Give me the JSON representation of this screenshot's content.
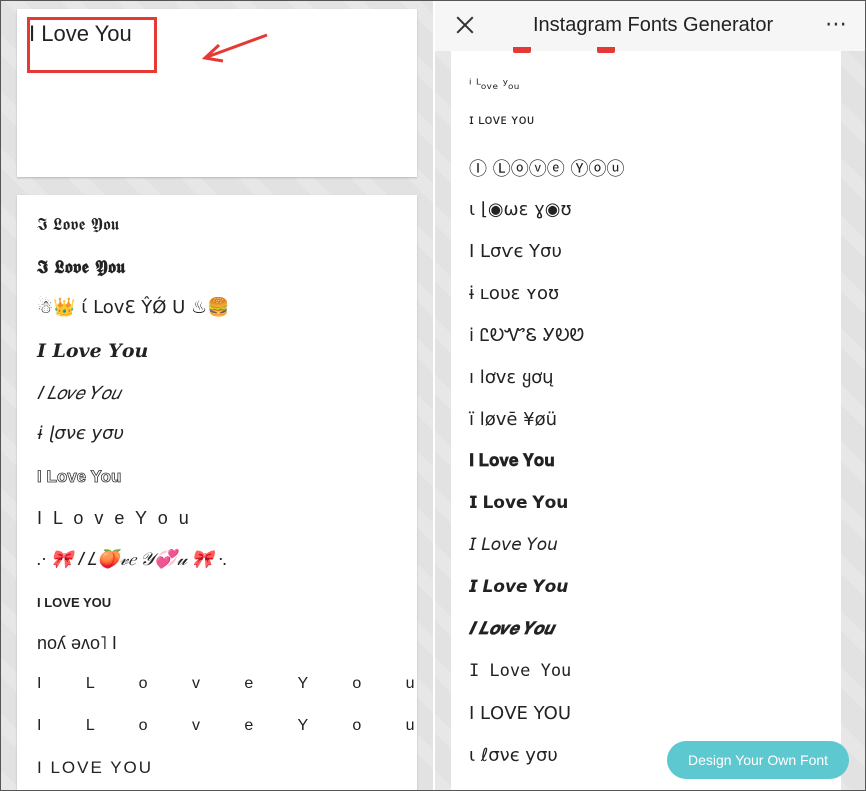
{
  "input": {
    "value": "I Love You"
  },
  "left_fonts": [
    "𝕴 𝕷𝖔𝖛𝖊 𝖄𝖔𝖚",
    "𝕴 𝕷𝖔𝖛𝖊 𝖄𝖔𝖚",
    "☃👑  ί LovƐ ŶǾ U  ♨🍔",
    "𝑰 𝑳𝒐𝒗𝒆 𝒀𝒐𝒖",
    "𝐼 𝐿𝑜𝑣𝑒 𝑌𝑜𝑢",
    "ɨ ɭσνє уσυ",
    "I Love You",
    "I L o v e Y o u",
    ".· 🎀 𝐼 𝐿🍑𝓋𝑒 𝒴💞𝓊 🎀 ·.",
    "I LOVE YOU",
    "noʎ ǝʌo˥ I",
    "I L o v e Y o u",
    "I L o v e Y o u",
    "I LOVE YOU"
  ],
  "header": {
    "title": "Instagram Fonts Generator",
    "more_icon": "⋯"
  },
  "right_fonts": [
    "ⁱ ᴸₒᵥₑ ʸₒᵤ",
    "ɪ ʟᴏᴠᴇ ʏᴏᴜ",
    "Ⓘ Ⓛⓞⓥⓔ Ⓨⓞⓤ",
    "ɩ ⌊◉⍵ɛ ɣ◉ʊ",
    "I Lσѵє Yσυ",
    "ɨ ʟօʋɛ ʏօʊ",
    "ⅰ ᏝᎧᏉᏋ ᎩᎧᏬ",
    "ı lơvɛ ყơų",
    "ï løvē ¥øü",
    "𝐈 𝐋𝐨𝐯𝐞 𝐘𝐨𝐮",
    "𝗜 𝗟𝗼𝘃𝗲 𝗬𝗼𝘂",
    "𝘐 𝘓𝘰𝘷𝘦 𝘠𝘰𝘶",
    "𝙄 𝙇𝙤𝙫𝙚 𝙔𝙤𝙪",
    "𝑰 𝑳𝒐𝒗𝒆 𝒀𝒐𝒖",
    "𝙸 𝙻𝚘𝚟𝚎 𝚈𝚘𝚞",
    "I ᒪOᐯE YOᑌ",
    "ι ℓσνє уσυ"
  ],
  "design_button": "Design Your Own Font",
  "colors": {
    "accent": "#5ec8d0",
    "highlight": "#e53935"
  }
}
